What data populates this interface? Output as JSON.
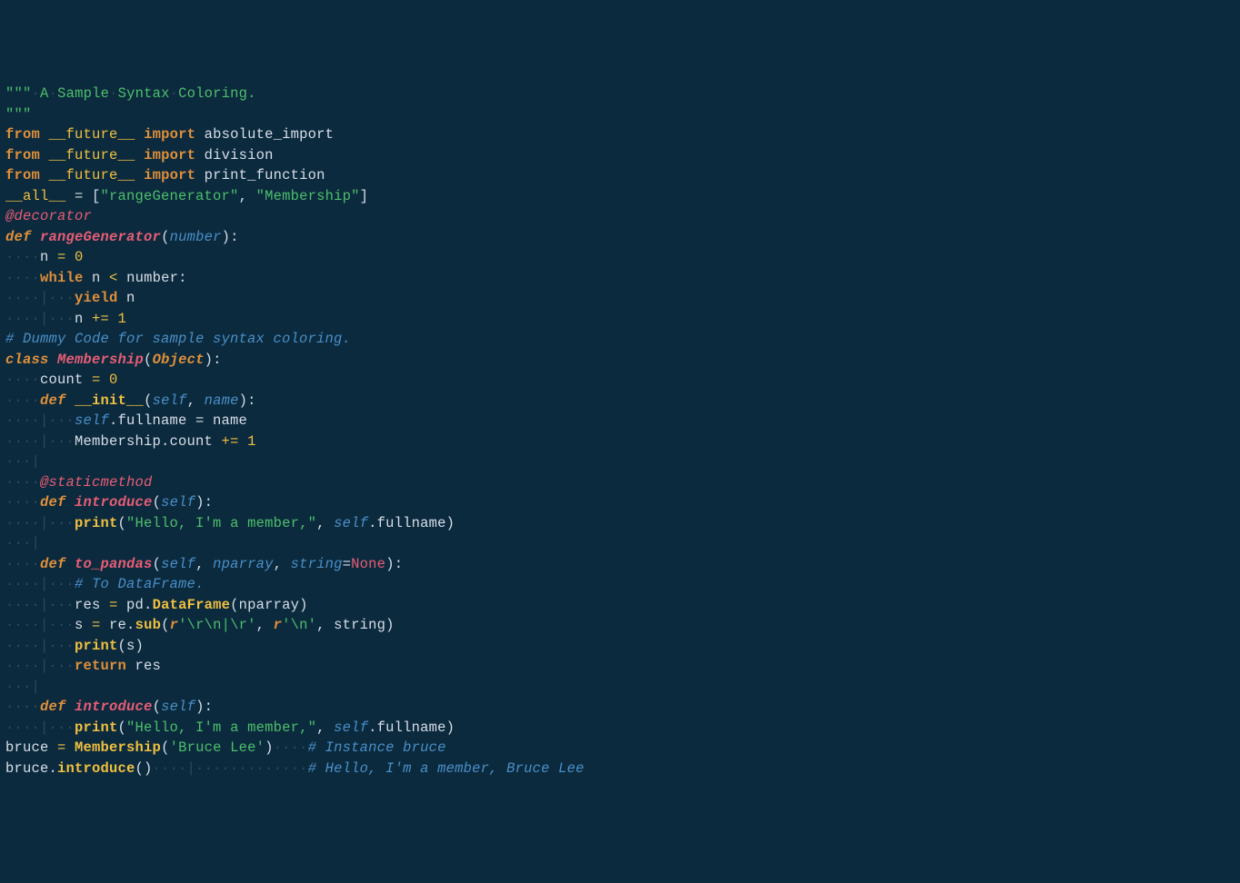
{
  "code": {
    "l01a": "\"\"\"",
    "l01b": "A",
    "l01c": "Sample",
    "l01d": "Syntax",
    "l01e": "Coloring.",
    "l02": "\"\"\"",
    "l04_from": "from",
    "l04_mod": "__future__",
    "l04_imp": "import",
    "l04_name": "absolute_import",
    "l05_name": "division",
    "l06_name": "print_function",
    "l08_all": "__all__",
    "l08_eq": " = [",
    "l08_s1": "\"rangeGenerator\"",
    "l08_c": ", ",
    "l08_s2": "\"Membership\"",
    "l08_end": "]",
    "l10_dec": "@decorator",
    "l11_def": "def",
    "l11_fn": "rangeGenerator",
    "l11_p": "number",
    "l12_n": "n ",
    "l12_eq": "=",
    "l12_z": " 0",
    "l13_while": "while",
    "l13_n": " n ",
    "l13_lt": "<",
    "l13_num": " number:",
    "l14_yield": "yield",
    "l14_n": " n",
    "l15_n": "n ",
    "l15_pe": "+=",
    "l15_1": " 1",
    "l17_cmt": "# Dummy Code for sample syntax coloring.",
    "l18_class": "class",
    "l18_name": "Membership",
    "l18_obj": "Object",
    "l19_count": "count ",
    "l19_eq": "=",
    "l19_z": " 0",
    "l20_def": "def",
    "l20_init": "__init__",
    "l20_self": "self",
    "l20_name": "name",
    "l21_self": "self",
    "l21_rest": ".fullname = name",
    "l22_mem": "Membership.count ",
    "l22_pe": "+=",
    "l22_1": " 1",
    "l24_dec": "@staticmethod",
    "l25_def": "def",
    "l25_fn": "introduce",
    "l25_self": "self",
    "l26_print": "print",
    "l26_str": "\"Hello, I'm a member,\"",
    "l26_self": "self",
    "l26_rest": ".fullname)",
    "l28_def": "def",
    "l28_fn": "to_pandas",
    "l28_self": "self",
    "l28_np": "nparray",
    "l28_str": "string",
    "l28_none": "None",
    "l29_cmt": "# To DataFrame.",
    "l30_res": "res ",
    "l30_eq": "=",
    "l30_pd": " pd.",
    "l30_df": "DataFrame",
    "l30_np": "(nparray)",
    "l31_s": "s ",
    "l31_eq": "=",
    "l31_re": " re.",
    "l31_sub": "sub",
    "l31_r1": "r",
    "l31_s1": "'\\r\\n|\\r'",
    "l31_r2": "r",
    "l31_s2": "'\\n'",
    "l31_end": ", string)",
    "l32_print": "print",
    "l32_s": "(s)",
    "l33_ret": "return",
    "l33_res": " res",
    "l35_def": "def",
    "l35_fn": "introduce",
    "l35_self": "self",
    "l36_print": "print",
    "l36_str": "\"Hello, I'm a member,\"",
    "l36_self": "self",
    "l36_rest": ".fullname)",
    "l39_bruce": "bruce ",
    "l39_eq": "=",
    "l39_mem": " Membership",
    "l39_str": "'Bruce Lee'",
    "l39_cmt": "# Instance bruce",
    "l40_bruce": "bruce.",
    "l40_fn": "introduce",
    "l40_p": "()",
    "l40_cmt": "# Hello, I'm a member, Bruce Lee"
  },
  "ws": {
    "dot": "·",
    "pipe": "|",
    "ind1_p": "····",
    "ind1_d": "···|",
    "ind2_p": "····|···",
    "ind2_d": "····|····"
  }
}
